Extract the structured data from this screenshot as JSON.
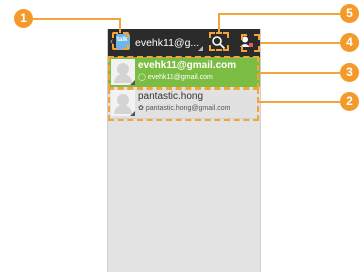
{
  "actionbar": {
    "back_glyph": "‹",
    "app_icon_label": "talk",
    "title": "evehk11@g..."
  },
  "accounts": [
    {
      "name": "evehk11@gmail.com",
      "sub": "evehk11@gmail.com",
      "sub_icon": "◯"
    },
    {
      "name": "pantastic.hong",
      "sub": "pantastic.hong@gmail.com",
      "sub_icon": "✿"
    }
  ],
  "callouts": [
    "1",
    "2",
    "3",
    "4",
    "5"
  ],
  "colors": {
    "accent": "#f39a2a",
    "selected_row": "#7bbd42",
    "actionbar": "#2b2b2b"
  },
  "icons": [
    "app-icon",
    "search-icon",
    "account-icon",
    "avatar-icon"
  ]
}
